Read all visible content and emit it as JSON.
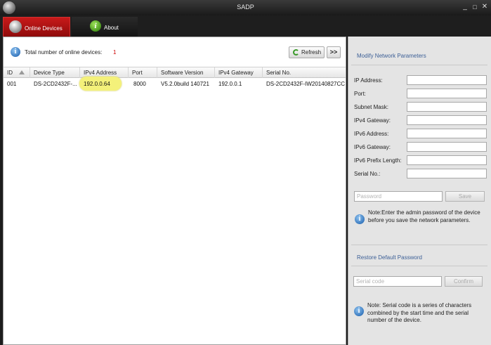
{
  "window": {
    "title": "SADP"
  },
  "window_controls": {
    "minimize": "_",
    "maximize": "□",
    "close": "✕"
  },
  "tabs": [
    {
      "label": "Online Devices",
      "icon": "devices-icon",
      "active": true
    },
    {
      "label": "About",
      "icon": "info-icon",
      "active": false
    }
  ],
  "toolbar": {
    "total_label": "Total number of online devices:",
    "total_count": "1",
    "refresh_label": "Refresh",
    "more_label": ">>"
  },
  "table": {
    "columns": [
      "ID",
      "Device Type",
      "IPv4 Address",
      "Port",
      "Software Version",
      "IPv4 Gateway",
      "Serial No."
    ],
    "rows": [
      [
        "001",
        "DS-2CD2432F-...",
        "192.0.0.64",
        "8000",
        "V5.2.0build 140721",
        "192.0.0.1",
        "DS-2CD2432F-IW20140827CC"
      ]
    ],
    "highlighted_cell": "IPv4 Address"
  },
  "modify": {
    "title": "Modify Network Parameters",
    "fields": [
      {
        "label": "IP Address:",
        "value": ""
      },
      {
        "label": "Port:",
        "value": ""
      },
      {
        "label": "Subnet Mask:",
        "value": ""
      },
      {
        "label": "IPv4 Gateway:",
        "value": ""
      },
      {
        "label": "IPv6 Address:",
        "value": ""
      },
      {
        "label": "IPv6 Gateway:",
        "value": ""
      },
      {
        "label": "IPv6 Prefix Length:",
        "value": ""
      },
      {
        "label": "Serial No.:",
        "value": ""
      }
    ],
    "password_placeholder": "Password",
    "save_label": "Save",
    "note": "Note:Enter the admin password of the device before you save the network parameters."
  },
  "restore": {
    "title": "Restore Default Password",
    "serial_placeholder": "Serial code",
    "confirm_label": "Confirm",
    "note": "Note: Serial code is a series of characters combined by the start time and the serial number of the device."
  },
  "colors": {
    "active_tab": "#b01414",
    "section_title": "#3c5f96",
    "count": "#cc0000",
    "highlight": "#f4f17a"
  }
}
